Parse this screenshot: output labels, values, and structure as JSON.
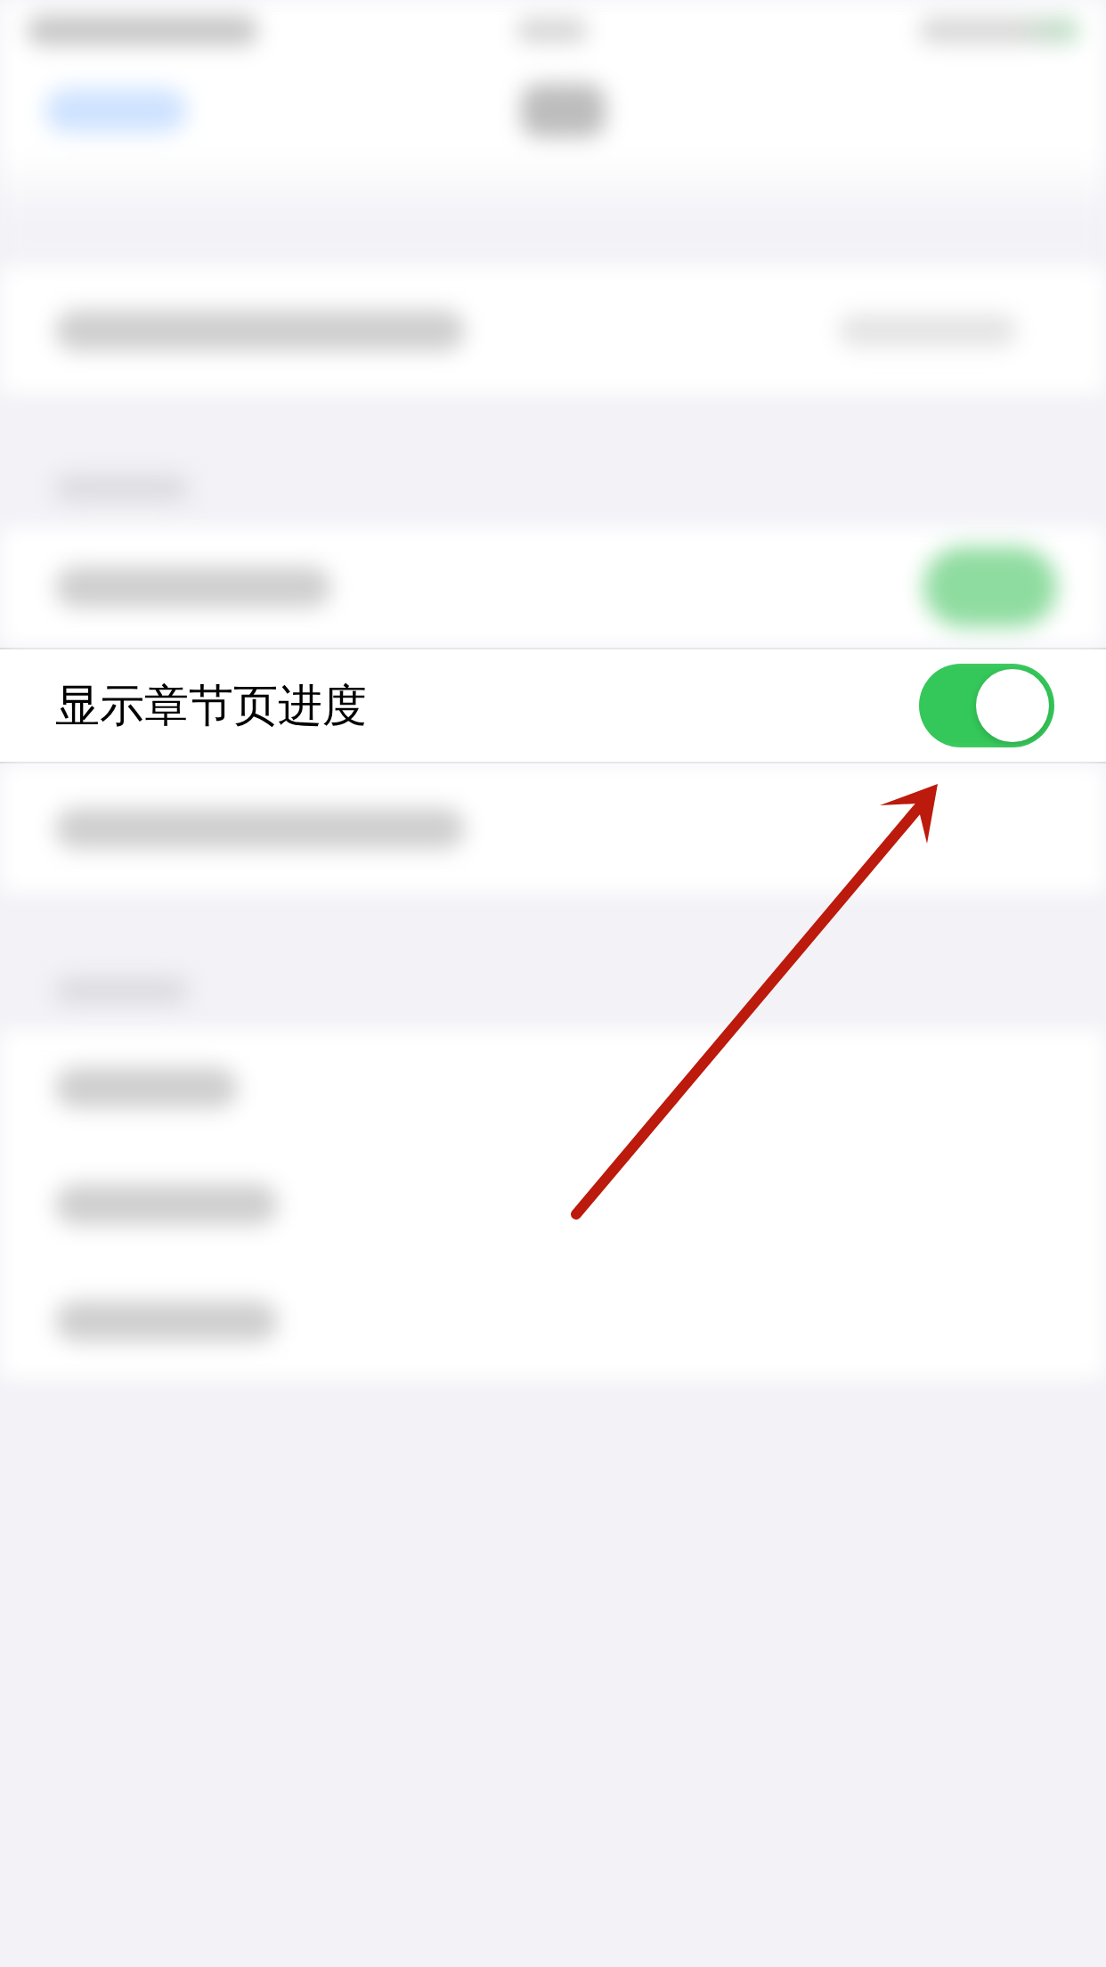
{
  "setting_row": {
    "label": "显示章节页进度",
    "on": true
  }
}
